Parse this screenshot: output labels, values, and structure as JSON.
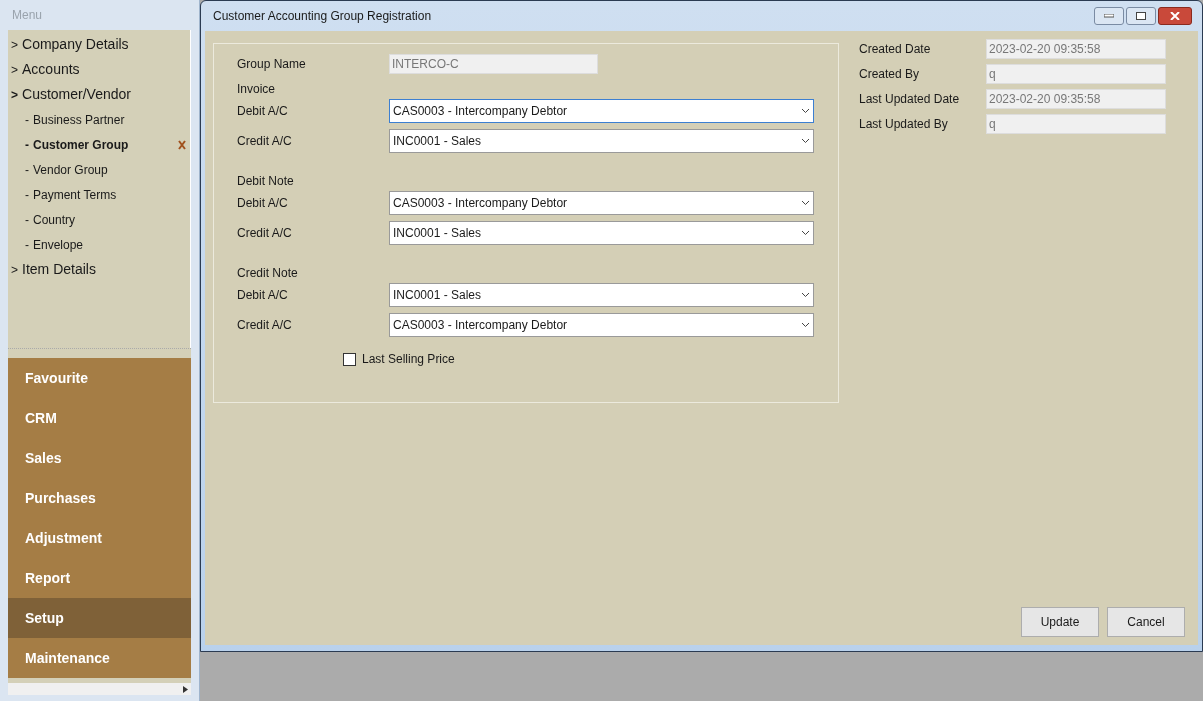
{
  "sidebar": {
    "title": "Menu",
    "tree": [
      {
        "label": "Company Details",
        "expanded": false
      },
      {
        "label": "Accounts",
        "expanded": false
      },
      {
        "label": "Customer/Vendor",
        "expanded": true,
        "children": [
          {
            "label": "Business Partner",
            "selected": false
          },
          {
            "label": "Customer Group",
            "selected": true
          },
          {
            "label": "Vendor Group",
            "selected": false
          },
          {
            "label": "Payment Terms",
            "selected": false
          },
          {
            "label": "Country",
            "selected": false
          },
          {
            "label": "Envelope",
            "selected": false
          }
        ]
      },
      {
        "label": "Item Details",
        "expanded": false
      }
    ],
    "tree_marker": ">",
    "child_marker": "-",
    "modules": [
      {
        "label": "Favourite",
        "selected": false
      },
      {
        "label": "CRM",
        "selected": false
      },
      {
        "label": "Sales",
        "selected": false
      },
      {
        "label": "Purchases",
        "selected": false
      },
      {
        "label": "Adjustment",
        "selected": false
      },
      {
        "label": "Report",
        "selected": false
      },
      {
        "label": "Setup",
        "selected": true
      },
      {
        "label": "Maintenance",
        "selected": false
      }
    ]
  },
  "window": {
    "title": "Customer Accounting Group Registration",
    "group_name": {
      "label": "Group Name",
      "value": "INTERCO-C"
    },
    "sections": [
      {
        "title": "Invoice",
        "fields": [
          {
            "label": "Debit A/C",
            "value": "CAS0003 - Intercompany Debtor",
            "focused": true
          },
          {
            "label": "Credit A/C",
            "value": "INC0001 - Sales",
            "focused": false
          }
        ]
      },
      {
        "title": "Debit Note",
        "fields": [
          {
            "label": "Debit A/C",
            "value": "CAS0003 - Intercompany Debtor",
            "focused": false
          },
          {
            "label": "Credit A/C",
            "value": "INC0001 - Sales",
            "focused": false
          }
        ]
      },
      {
        "title": "Credit Note",
        "fields": [
          {
            "label": "Debit A/C",
            "value": "INC0001 - Sales",
            "focused": false
          },
          {
            "label": "Credit A/C",
            "value": "CAS0003 - Intercompany Debtor",
            "focused": false
          }
        ]
      }
    ],
    "checkbox": {
      "label": "Last Selling Price",
      "checked": false
    },
    "info": [
      {
        "label": "Created Date",
        "value": "2023-02-20 09:35:58"
      },
      {
        "label": "Created By",
        "value": "q"
      },
      {
        "label": "Last Updated Date",
        "value": "2023-02-20 09:35:58"
      },
      {
        "label": "Last Updated By",
        "value": "q"
      }
    ],
    "buttons": [
      "Update",
      "Cancel"
    ]
  }
}
